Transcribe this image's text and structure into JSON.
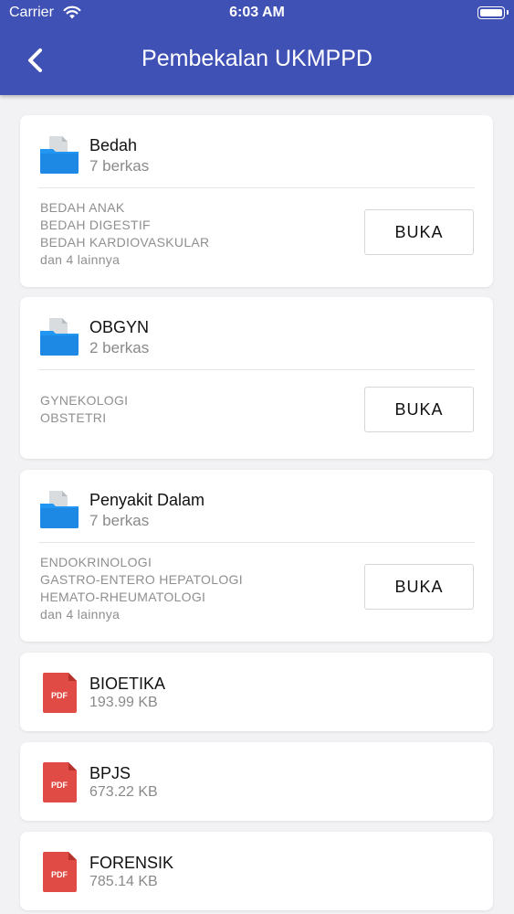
{
  "status_bar": {
    "carrier": "Carrier",
    "time": "6:03 AM"
  },
  "header": {
    "title": "Pembekalan UKMPPD"
  },
  "folders": [
    {
      "title": "Bedah",
      "count": "7 berkas",
      "subs": [
        "BEDAH ANAK",
        "BEDAH DIGESTIF",
        "BEDAH KARDIOVASKULAR"
      ],
      "more": "dan 4 lainnya",
      "button": "BUKA"
    },
    {
      "title": "OBGYN",
      "count": "2 berkas",
      "subs": [
        "GYNEKOLOGI",
        "OBSTETRI"
      ],
      "more": "",
      "button": "BUKA"
    },
    {
      "title": "Penyakit Dalam",
      "count": "7 berkas",
      "subs": [
        "ENDOKRINOLOGI",
        "GASTRO-ENTERO HEPATOLOGI",
        "HEMATO-RHEUMATOLOGI"
      ],
      "more": "dan 4 lainnya",
      "button": "BUKA"
    }
  ],
  "files": [
    {
      "title": "BIOETIKA",
      "size": "193.99 KB",
      "icon_label": "PDF"
    },
    {
      "title": "BPJS",
      "size": "673.22 KB",
      "icon_label": "PDF"
    },
    {
      "title": "FORENSIK",
      "size": "785.14 KB",
      "icon_label": "PDF"
    }
  ],
  "colors": {
    "header": "#3f51b5",
    "folder": "#2196f3",
    "pdf": "#e14b45"
  }
}
